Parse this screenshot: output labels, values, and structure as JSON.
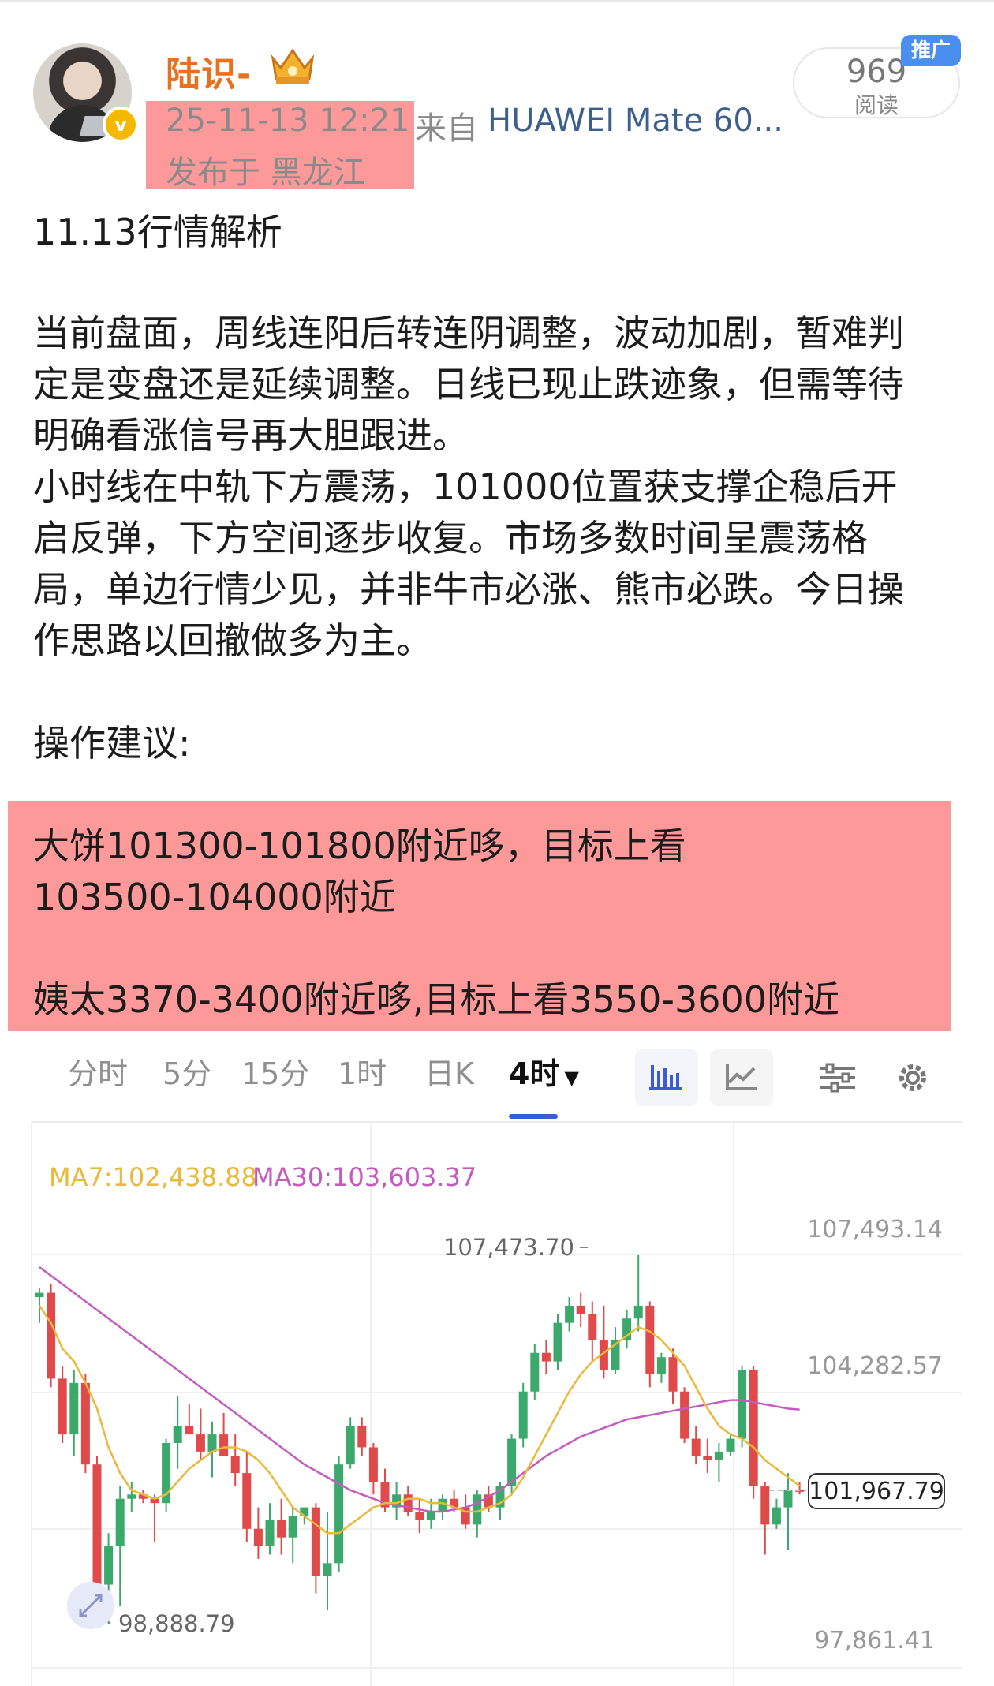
{
  "post": {
    "username": "陆识-",
    "timestamp": "25-11-13 12:21",
    "source_prefix": "来自",
    "device": "HUAWEI Mate 60...",
    "location": "发布于 黑龙江",
    "read_count": "969",
    "read_label": "阅读",
    "promo_badge": "推广",
    "paragraphs": [
      "11.13行情解析",
      "当前盘面，周线连阳后转连阴调整，波动加剧，暂难判",
      "定是变盘还是延续调整。日线已现止跌迹象，但需等待",
      "明确看涨信号再大胆跟进。",
      "小时线在中轨下方震荡，101000位置获支撑企稳后开",
      "启反弹，下方空间逐步收复。市场多数时间呈震荡格",
      "局，单边行情少见，并非牛市必涨、熊市必跌。今日操",
      "作思路以回撤做多为主。",
      "操作建议:",
      "大饼101300-101800附近哆，目标上看",
      "103500-104000附近",
      "姨太3370-3400附近哆,目标上看3550-3600附近"
    ]
  },
  "chart_tabs": [
    "分时",
    "5分",
    "15分",
    "1时",
    "日K",
    "4时"
  ],
  "chart_active_tab": "4时",
  "chart_tools": [
    "candlestick-icon",
    "line-chart-icon",
    "indicator-settings-icon",
    "gear-icon"
  ],
  "colors": {
    "up": "#3aa96b",
    "down": "#e04a4a",
    "ma7": "#e8b93a",
    "ma30": "#c45cbf",
    "username": "#e8701e",
    "tab_accent": "#3b5bd9"
  },
  "chart_data": {
    "type": "candlestick",
    "ma7_label": "MA7:102,438.88",
    "ma30_label": "MA30:103,603.37",
    "price_labels": [
      "107,493.14",
      "104,282.57",
      "97,861.41"
    ],
    "current_price": "101,967.79",
    "high_label": "107,473.70",
    "low_label": "98,888.79",
    "ylim": [
      97861.41,
      107493.14
    ],
    "candles": [
      [
        106500,
        106700,
        105900,
        106600
      ],
      [
        106600,
        106800,
        104400,
        104600
      ],
      [
        104600,
        104900,
        103100,
        103300
      ],
      [
        103300,
        104800,
        102800,
        104500
      ],
      [
        104500,
        104700,
        102400,
        102600
      ],
      [
        102600,
        102800,
        99500,
        99800
      ],
      [
        99800,
        101000,
        98889,
        100700
      ],
      [
        100700,
        102100,
        99300,
        101800
      ],
      [
        101800,
        102200,
        101500,
        101900
      ],
      [
        101900,
        102000,
        101700,
        101800
      ],
      [
        101800,
        101900,
        100800,
        101700
      ],
      [
        101700,
        103200,
        101500,
        103100
      ],
      [
        103100,
        104200,
        102500,
        103500
      ],
      [
        103500,
        104000,
        103300,
        103300
      ],
      [
        103300,
        103900,
        102700,
        102900
      ],
      [
        102900,
        103600,
        102300,
        103300
      ],
      [
        103300,
        103800,
        102800,
        102800
      ],
      [
        102800,
        103300,
        102100,
        102400
      ],
      [
        102400,
        102900,
        100800,
        101100
      ],
      [
        101100,
        101600,
        100400,
        100700
      ],
      [
        100700,
        101700,
        100500,
        101300
      ],
      [
        101300,
        101800,
        100500,
        100900
      ],
      [
        100900,
        101600,
        100300,
        101400
      ],
      [
        101400,
        101600,
        101200,
        101600
      ],
      [
        101600,
        101700,
        99600,
        100000
      ],
      [
        100000,
        101500,
        99200,
        100300
      ],
      [
        100300,
        102800,
        100100,
        102600
      ],
      [
        102600,
        103700,
        102500,
        103500
      ],
      [
        103500,
        103700,
        102800,
        103000
      ],
      [
        103000,
        103100,
        101900,
        102200
      ],
      [
        102200,
        102500,
        101500,
        101600
      ],
      [
        101600,
        102200,
        101300,
        101900
      ],
      [
        101900,
        102100,
        101400,
        101500
      ],
      [
        101500,
        101800,
        101000,
        101300
      ],
      [
        101300,
        101800,
        101100,
        101500
      ],
      [
        101500,
        101900,
        101300,
        101800
      ],
      [
        101800,
        102000,
        101500,
        101600
      ],
      [
        101600,
        101900,
        101100,
        101200
      ],
      [
        101200,
        102000,
        100900,
        101900
      ],
      [
        101900,
        102100,
        101500,
        101600
      ],
      [
        101600,
        102200,
        101300,
        102100
      ],
      [
        102100,
        103300,
        101900,
        103200
      ],
      [
        103200,
        104500,
        103000,
        104300
      ],
      [
        104300,
        105400,
        104100,
        105200
      ],
      [
        105200,
        105500,
        104700,
        105000
      ],
      [
        105000,
        106100,
        104800,
        105900
      ],
      [
        105900,
        106500,
        105700,
        106300
      ],
      [
        106300,
        106600,
        105800,
        106100
      ],
      [
        106100,
        106400,
        105000,
        105500
      ],
      [
        105500,
        106300,
        104600,
        104800
      ],
      [
        104800,
        105800,
        104700,
        105500
      ],
      [
        105500,
        106200,
        105300,
        106000
      ],
      [
        106000,
        107474,
        105700,
        106300
      ],
      [
        106300,
        106400,
        104400,
        104700
      ],
      [
        104700,
        105200,
        104500,
        105100
      ],
      [
        105100,
        105300,
        104000,
        104300
      ],
      [
        104300,
        104400,
        103100,
        103200
      ],
      [
        103200,
        103500,
        102600,
        102800
      ],
      [
        102800,
        103200,
        102400,
        102700
      ],
      [
        102700,
        103100,
        102200,
        102900
      ],
      [
        102900,
        103300,
        102800,
        103200
      ],
      [
        103200,
        104900,
        103000,
        104800
      ],
      [
        104800,
        104900,
        101800,
        102100
      ],
      [
        102100,
        102200,
        100500,
        101200
      ],
      [
        101200,
        101800,
        101100,
        101600
      ],
      [
        101600,
        102400,
        100600,
        102000
      ],
      [
        102000,
        102200,
        101900,
        101968
      ]
    ],
    "ma7": [
      106300,
      105900,
      105300,
      105000,
      104500,
      103900,
      103000,
      102400,
      102000,
      101900,
      101800,
      101900,
      102200,
      102500,
      102700,
      102900,
      103000,
      103000,
      102900,
      102700,
      102400,
      102000,
      101600,
      101400,
      101200,
      101000,
      101000,
      101200,
      101400,
      101600,
      101700,
      101700,
      101800,
      101800,
      101700,
      101700,
      101600,
      101500,
      101500,
      101600,
      101700,
      101900,
      102300,
      102800,
      103300,
      103800,
      104300,
      104700,
      105000,
      105200,
      105400,
      105600,
      105800,
      105700,
      105500,
      105200,
      104900,
      104400,
      103900,
      103500,
      103300,
      103200,
      103000,
      102700,
      102500,
      102300,
      102100
    ],
    "ma30": [
      107200,
      107000,
      106800,
      106600,
      106400,
      106200,
      106000,
      105800,
      105600,
      105400,
      105200,
      105000,
      104800,
      104600,
      104400,
      104200,
      104000,
      103800,
      103600,
      103400,
      103200,
      103000,
      102800,
      102600,
      102450,
      102300,
      102150,
      102000,
      101900,
      101800,
      101700,
      101650,
      101600,
      101550,
      101500,
      101500,
      101550,
      101600,
      101700,
      101850,
      102000,
      102200,
      102400,
      102600,
      102800,
      102950,
      103100,
      103250,
      103350,
      103450,
      103550,
      103650,
      103700,
      103750,
      103800,
      103850,
      103900,
      103950,
      104000,
      104050,
      104100,
      104100,
      104050,
      104000,
      103950,
      103900,
      103880
    ]
  }
}
